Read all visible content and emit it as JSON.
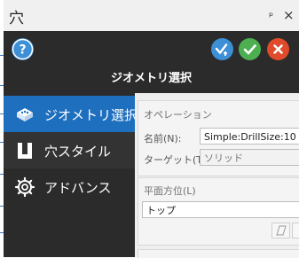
{
  "window": {
    "title": "穴",
    "pin_glyph": "ᵖ",
    "close_glyph": "×"
  },
  "header": {
    "title": "ジオメトリ選択",
    "icons": [
      "help-icon",
      "apply-keep-open-icon",
      "ok-check-icon",
      "cancel-x-icon"
    ],
    "colors": {
      "help": "#3d8fd6",
      "apply": "#3d8fd6",
      "ok": "#4caf50",
      "cancel": "#e04b2b"
    }
  },
  "sidebar": {
    "items": [
      {
        "label": "ジオメトリ選択",
        "icon": "geometry-cube-icon",
        "active": true
      },
      {
        "label": "穴スタイル",
        "icon": "hole-style-icon",
        "active": false
      },
      {
        "label": "アドバンス",
        "icon": "gear-icon",
        "active": false
      }
    ],
    "accent": "#1f6fbf"
  },
  "operation": {
    "section_label": "オペレーション",
    "name_label": "名前(N):",
    "name_value": "Simple:DrillSize:10",
    "target_label": "ターゲット(T):",
    "target_value": "ソリッド"
  },
  "plane": {
    "section_label": "平面方位(L)",
    "value": "トップ"
  }
}
